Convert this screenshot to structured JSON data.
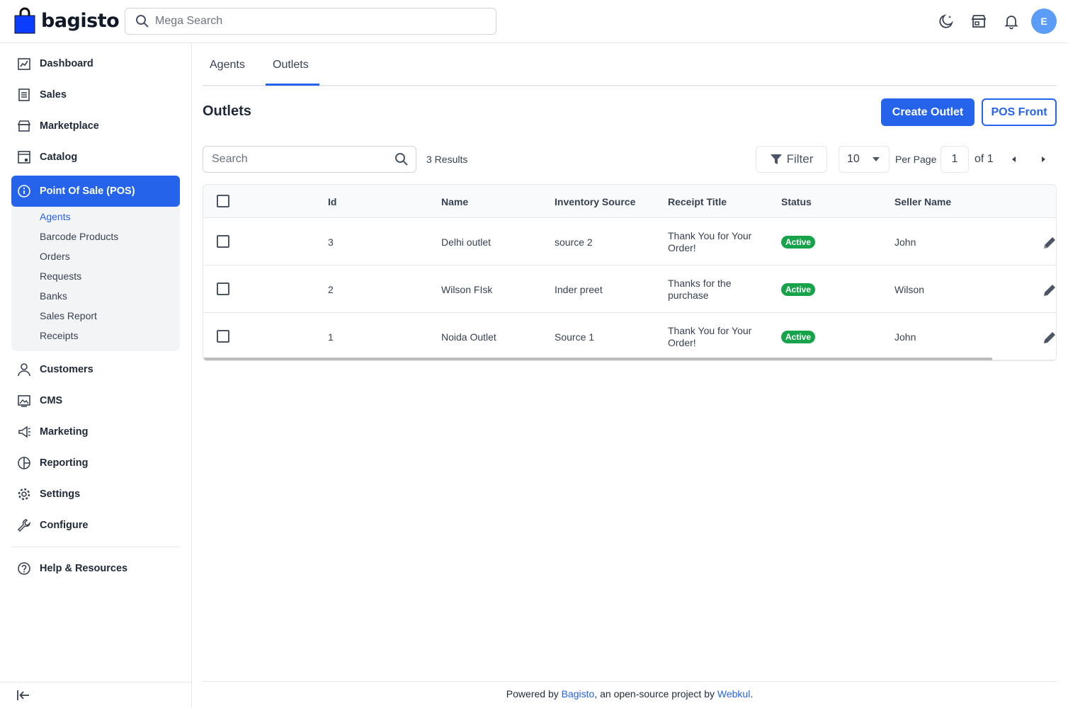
{
  "brand": {
    "name": "bagisto",
    "accent": "#2563eb",
    "success": "#16a34a"
  },
  "header": {
    "search_placeholder": "Mega Search",
    "icons": [
      "moon-icon",
      "store-icon",
      "bell-icon"
    ],
    "avatar_initial": "E"
  },
  "sidebar": {
    "items": [
      {
        "label": "Dashboard",
        "icon": "dashboard-icon"
      },
      {
        "label": "Sales",
        "icon": "sales-icon"
      },
      {
        "label": "Marketplace",
        "icon": "marketplace-icon"
      },
      {
        "label": "Catalog",
        "icon": "catalog-icon"
      },
      {
        "label": "Point Of Sale (POS)",
        "icon": "info-icon",
        "active": true
      },
      {
        "label": "Customers",
        "icon": "customer-icon"
      },
      {
        "label": "CMS",
        "icon": "cms-icon"
      },
      {
        "label": "Marketing",
        "icon": "megaphone-icon"
      },
      {
        "label": "Reporting",
        "icon": "pie-chart-icon"
      },
      {
        "label": "Settings",
        "icon": "gear-icon"
      },
      {
        "label": "Configure",
        "icon": "wrench-icon"
      },
      {
        "label": "Help & Resources",
        "icon": "help-icon"
      }
    ],
    "pos_sub_items": [
      "Agents",
      "Barcode Products",
      "Orders",
      "Requests",
      "Banks",
      "Sales Report",
      "Receipts"
    ]
  },
  "tabs": [
    "Agents",
    "Outlets"
  ],
  "page": {
    "title": "Outlets",
    "create_button": "Create Outlet",
    "pos_front_button": "POS Front"
  },
  "toolbar": {
    "search_placeholder": "Search",
    "results": "3 Results",
    "filter_label": "Filter",
    "per_page_value": "10",
    "per_page_label": "Per Page",
    "page_value": "1",
    "page_of": "of 1"
  },
  "table": {
    "columns": [
      "Id",
      "Name",
      "Inventory Source",
      "Receipt Title",
      "Status",
      "Seller Name"
    ],
    "rows": [
      {
        "id": "3",
        "name": "Delhi outlet",
        "source": "source 2",
        "receipt_line1": "Thank You for Your",
        "receipt_line2": "Order!",
        "status": "Active",
        "seller": "John"
      },
      {
        "id": "2",
        "name": "Wilson FIsk",
        "source": "Inder preet",
        "receipt_line1": "Thanks for the",
        "receipt_line2": "purchase",
        "status": "Active",
        "seller": "Wilson"
      },
      {
        "id": "1",
        "name": "Noida Outlet",
        "source": "Source 1",
        "receipt_line1": "Thank You for Your",
        "receipt_line2": "Order!",
        "status": "Active",
        "seller": "John"
      }
    ]
  },
  "footer": {
    "prefix": "Powered by ",
    "bagisto_link": "Bagisto",
    "middle": ", an open-source project by ",
    "webkul_link": "Webkul",
    "suffix": "."
  }
}
